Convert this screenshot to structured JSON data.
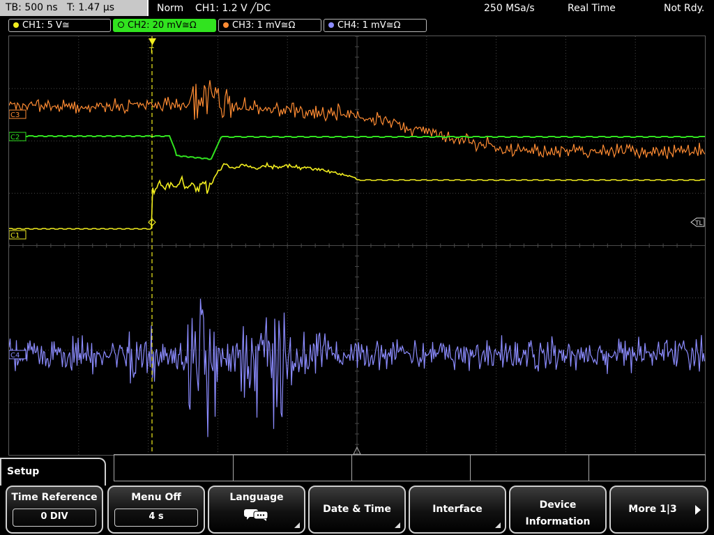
{
  "status": {
    "timebase": "TB: 500 ns",
    "trigger_time": "T: 1.47 µs",
    "acq_mode": "Norm",
    "trigger_info": "CH1: 1.2 V ╱DC",
    "sample_rate": "250 MSa/s",
    "realtime": "Real Time",
    "state": "Not Rdy."
  },
  "channels": [
    {
      "label": "CH1: 5 V≅",
      "color": "#f2ee1f"
    },
    {
      "label": "CH2: 20 mV≅Ω",
      "color": "#31e31f"
    },
    {
      "label": "CH3: 1 mV≅Ω",
      "color": "#ff8c33"
    },
    {
      "label": "CH4: 1 mV≅Ω",
      "color": "#8c8cff"
    }
  ],
  "markers": {
    "ch3": "C3",
    "ch2": "C2",
    "ch1": "C1",
    "ch4": "C4",
    "trigger_level": "TL",
    "trigger_pos": "T"
  },
  "setup_menu": {
    "title": "Setup",
    "softkeys": [
      {
        "label": "Time Reference",
        "value": "0 DIV"
      },
      {
        "label": "Menu Off",
        "value": "4 s"
      },
      {
        "label": "Language",
        "icon": "speech-bubbles-icon"
      },
      {
        "label": "Date & Time"
      },
      {
        "label": "Interface"
      },
      {
        "label_line1": "Device",
        "label_line2": "Information"
      },
      {
        "label": "More 1|3"
      }
    ]
  },
  "colors": {
    "accent_green": "#31e31f",
    "grid": "#4a4a4a"
  }
}
